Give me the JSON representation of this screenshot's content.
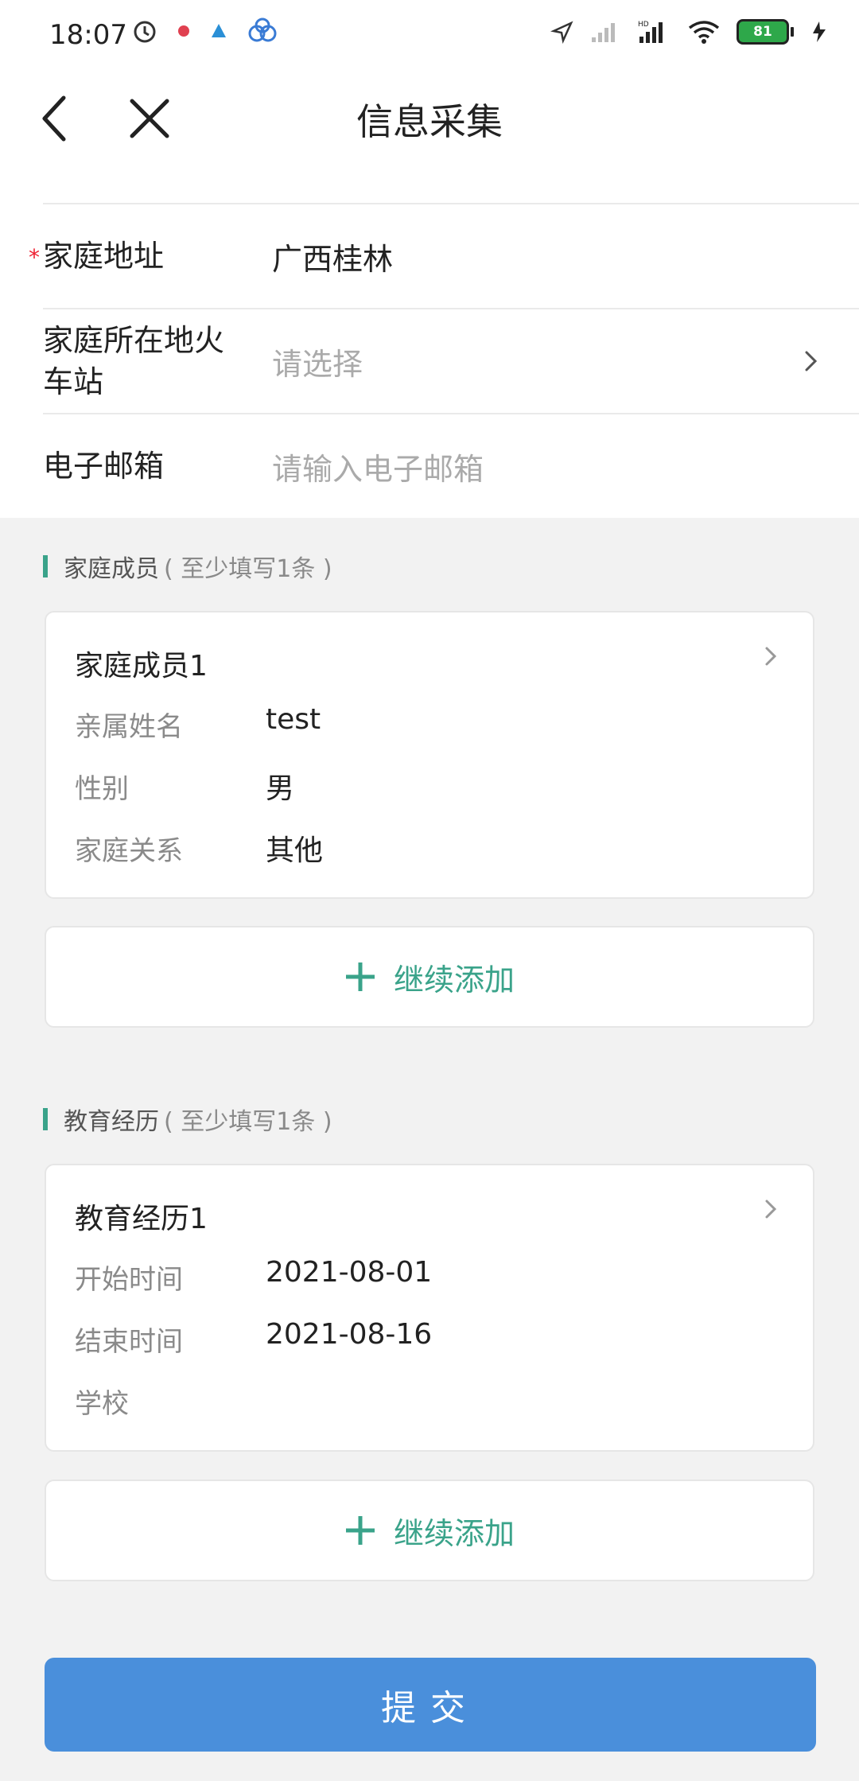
{
  "status_bar": {
    "time": "18:07",
    "battery": "81"
  },
  "header": {
    "title": "信息采集"
  },
  "form": {
    "address": {
      "label": "家庭地址",
      "required_mark": "*",
      "value": "广西桂林"
    },
    "station": {
      "label_line1": "家庭所在地火",
      "label_line2": "车站",
      "placeholder": "请选择"
    },
    "email": {
      "label": "电子邮箱",
      "placeholder": "请输入电子邮箱"
    }
  },
  "family": {
    "section_title": "家庭成员",
    "section_hint": "( 至少填写1条 )",
    "card": {
      "title": "家庭成员1",
      "fields": [
        {
          "label": "亲属姓名",
          "value": "test"
        },
        {
          "label": "性别",
          "value": "男"
        },
        {
          "label": "家庭关系",
          "value": "其他"
        }
      ]
    },
    "add_label": "继续添加"
  },
  "education": {
    "section_title": "教育经历",
    "section_hint": "( 至少填写1条 )",
    "card": {
      "title": "教育经历1",
      "fields": [
        {
          "label": "开始时间",
          "value": "2021-08-01"
        },
        {
          "label": "结束时间",
          "value": "2021-08-16"
        },
        {
          "label": "学校",
          "value": ""
        }
      ]
    },
    "add_label": "继续添加"
  },
  "submit_label": "提交",
  "colors": {
    "accent": "#3aa38a",
    "primary": "#4a8fdb",
    "required": "#e23333"
  }
}
